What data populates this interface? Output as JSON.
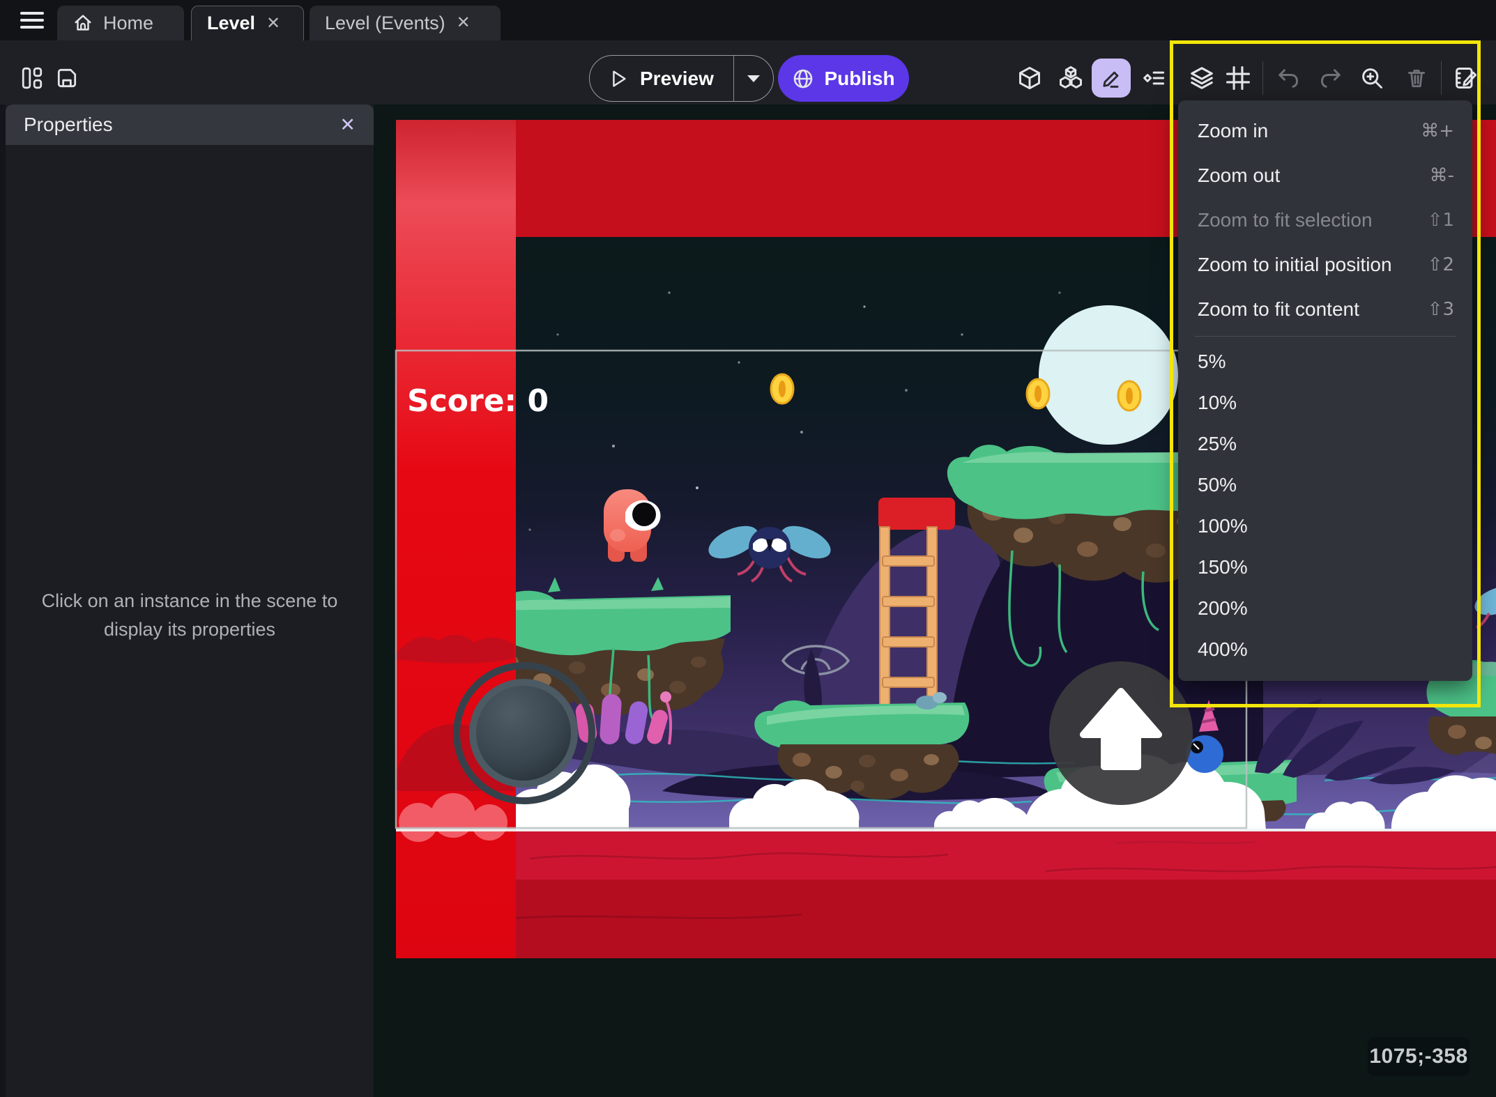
{
  "app": {
    "close_glyph": "✕"
  },
  "tabbar": {
    "tabs": [
      {
        "label": "Home"
      },
      {
        "label": "Level"
      },
      {
        "label": "Level (Events)"
      }
    ]
  },
  "toolbar": {
    "preview_label": "Preview",
    "publish_label": "Publish"
  },
  "properties_panel": {
    "title": "Properties",
    "empty_message": "Click on an instance in the scene to display its properties"
  },
  "zoom_menu": {
    "items": [
      {
        "label": "Zoom in",
        "shortcut": "⌘+",
        "disabled": false
      },
      {
        "label": "Zoom out",
        "shortcut": "⌘-",
        "disabled": false
      },
      {
        "label": "Zoom to fit selection",
        "shortcut": "⇧1",
        "disabled": true
      },
      {
        "label": "Zoom to initial position",
        "shortcut": "⇧2",
        "disabled": false
      },
      {
        "label": "Zoom to fit content",
        "shortcut": "⇧3",
        "disabled": false
      }
    ],
    "zoom_levels": [
      "5%",
      "10%",
      "25%",
      "50%",
      "100%",
      "150%",
      "200%",
      "400%"
    ]
  },
  "scene": {
    "score_text": "Score: 0",
    "coordinates_display": "1075;-358"
  },
  "colors": {
    "accent_purple": "#5B37E8",
    "highlight_yellow": "#F3E50A",
    "active_tool_bg": "#C9BDF6",
    "scene_red": "#E30612"
  }
}
